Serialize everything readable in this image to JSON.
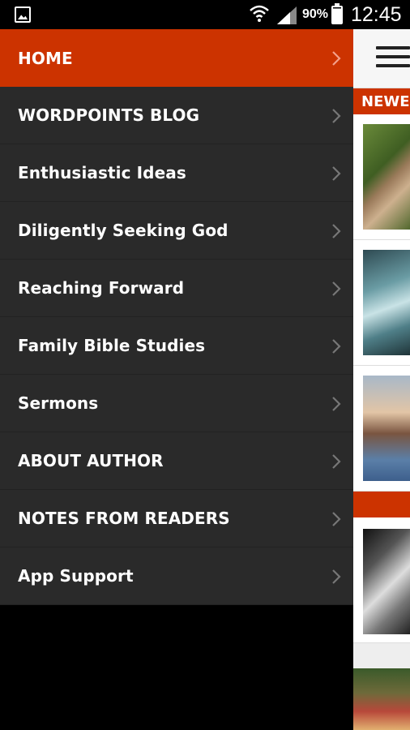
{
  "status_bar": {
    "battery_percent": "90%",
    "time": "12:45",
    "icons": [
      "gallery-icon",
      "wifi-icon",
      "signal-icon",
      "battery-icon"
    ]
  },
  "drawer": {
    "items": [
      {
        "label": "HOME",
        "active": true
      },
      {
        "label": "WORDPOINTS BLOG",
        "active": false
      },
      {
        "label": "Enthusiastic Ideas",
        "active": false
      },
      {
        "label": "Diligently Seeking God",
        "active": false
      },
      {
        "label": "Reaching Forward",
        "active": false
      },
      {
        "label": "Family Bible Studies",
        "active": false
      },
      {
        "label": "Sermons",
        "active": false
      },
      {
        "label": "ABOUT AUTHOR",
        "active": false
      },
      {
        "label": "NOTES FROM READERS",
        "active": false
      },
      {
        "label": "App Support",
        "active": false
      }
    ]
  },
  "content": {
    "section_title": "NEWEST",
    "menu_icon": "hamburger-icon"
  },
  "colors": {
    "accent": "#cc3300",
    "drawer_bg": "#2a2a2a",
    "text": "#ffffff"
  }
}
